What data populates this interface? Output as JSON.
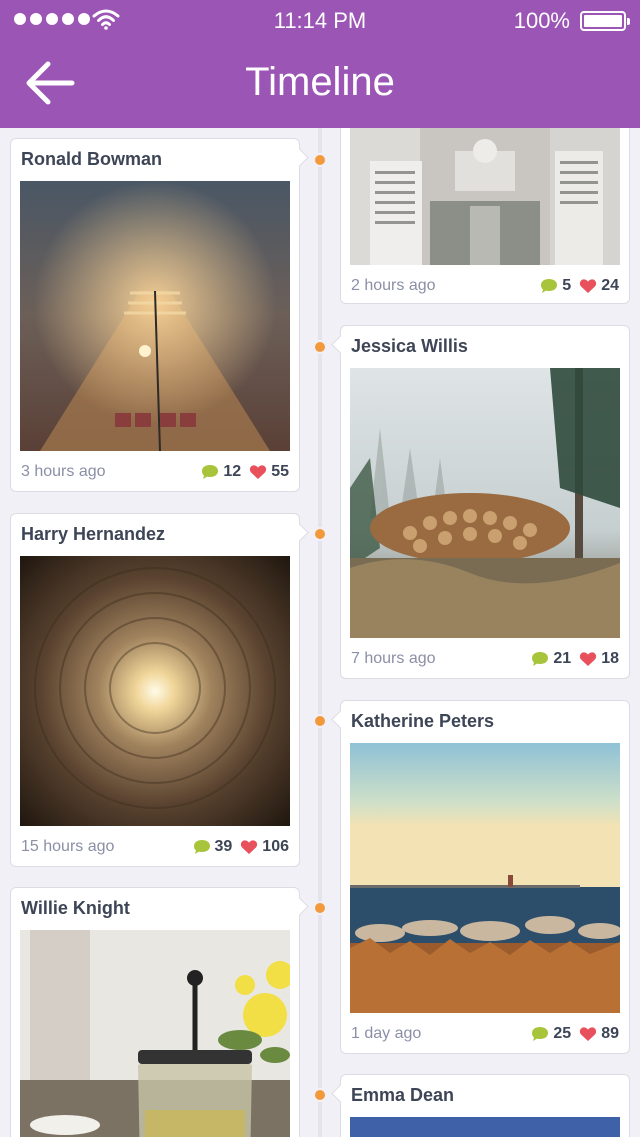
{
  "status": {
    "time": "11:14 PM",
    "battery": "100%"
  },
  "header": {
    "title": "Timeline"
  },
  "posts": [
    {
      "name": "",
      "time": "2 hours ago",
      "comments": "5",
      "likes": "24",
      "photo": "city"
    },
    {
      "name": "Ronald Bowman",
      "time": "3 hours ago",
      "comments": "12",
      "likes": "55",
      "photo": "railway"
    },
    {
      "name": "Jessica Willis",
      "time": "7 hours ago",
      "comments": "21",
      "likes": "18",
      "photo": "logs"
    },
    {
      "name": "Harry Hernandez",
      "time": "15 hours ago",
      "comments": "39",
      "likes": "106",
      "photo": "tunnel"
    },
    {
      "name": "Katherine Peters",
      "time": "1 day ago",
      "comments": "25",
      "likes": "89",
      "photo": "sea"
    },
    {
      "name": "Willie Knight",
      "photo": "tea"
    },
    {
      "name": "Emma Dean",
      "photo": "blue"
    }
  ],
  "colors": {
    "header": "#9b55b5",
    "dot": "#f3993b",
    "comment": "#a8c43a",
    "like": "#e8505b"
  },
  "icons": [
    "back-arrow-icon",
    "wifi-icon",
    "battery-icon",
    "comment-icon",
    "heart-icon"
  ]
}
